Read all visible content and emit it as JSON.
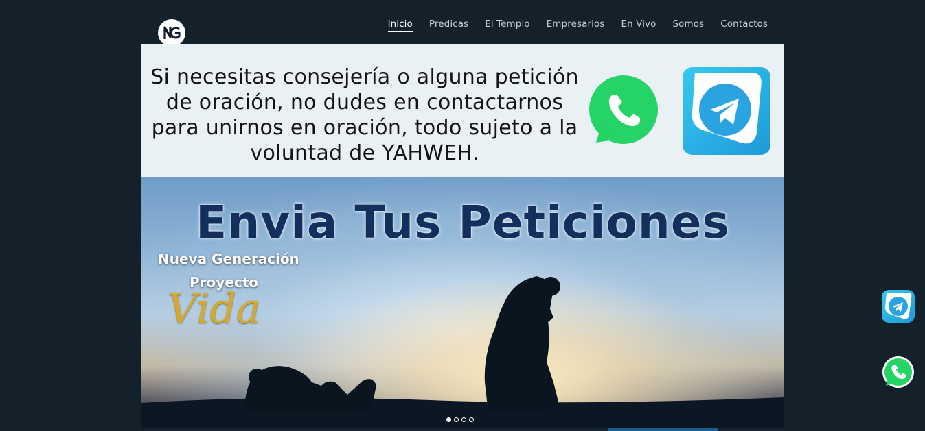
{
  "header": {
    "logo_alt": "NG",
    "nav": [
      {
        "label": "Inicio",
        "active": true
      },
      {
        "label": "Predicas",
        "active": false
      },
      {
        "label": "El Templo",
        "active": false
      },
      {
        "label": "Empresarios",
        "active": false
      },
      {
        "label": "En Vivo",
        "active": false
      },
      {
        "label": "Somos",
        "active": false
      },
      {
        "label": "Contactos",
        "active": false
      }
    ]
  },
  "banner": {
    "text": "Si necesitas consejería o alguna petición de oración, no dudes en contactarnos para unirnos en oración, todo sujeto a la voluntad de YAHWEH.",
    "icons": [
      "whatsapp-icon",
      "telegram-icon"
    ],
    "whatsapp_color": "#25D366",
    "telegram_color": "#2AA3E0"
  },
  "slider": {
    "title": "Envia Tus Peticiones",
    "subtitle_line1": "Nueva Generación",
    "subtitle_line2": "Proyecto",
    "subtitle_script": "Vida",
    "slide_count": 4,
    "active_slide": 1
  },
  "floating": {
    "telegram": "telegram-icon",
    "whatsapp": "whatsapp-icon"
  }
}
